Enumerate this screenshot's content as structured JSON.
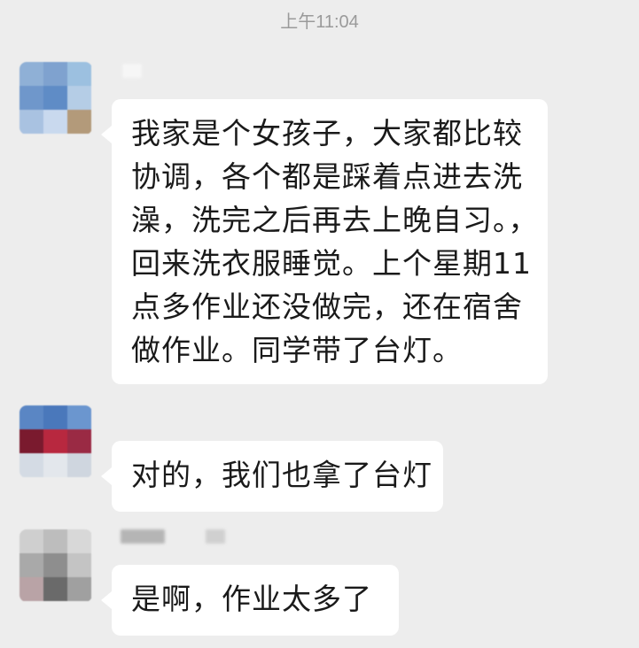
{
  "chat": {
    "timestamp": "上午11:04",
    "messages": [
      {
        "lines": [
          "我家是个女孩子，大家都比较",
          "协调，各个都是踩着点进去洗",
          "澡，洗完之后再去上晚自习。，",
          "回来洗衣服睡觉。上个星期11",
          "点多作业还没做完，还在宿舍",
          "做作业。同学带了台灯。"
        ]
      },
      {
        "lines": [
          "对的，我们也拿了台灯"
        ]
      },
      {
        "lines": [
          "是啊，作业太多了"
        ]
      }
    ]
  }
}
